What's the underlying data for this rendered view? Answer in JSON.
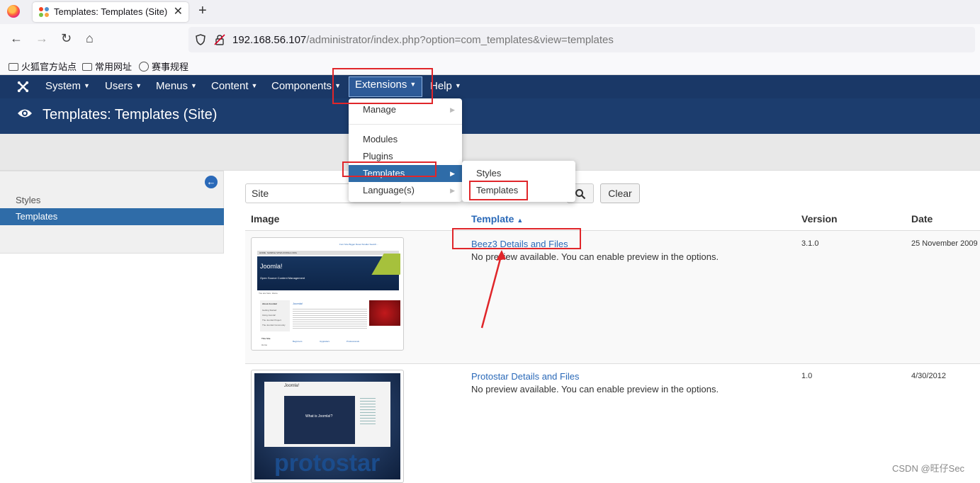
{
  "browser": {
    "tab_title": "Templates: Templates (Site) - ",
    "url_host": "192.168.56.107",
    "url_path": "/administrator/index.php?option=com_templates&view=templates",
    "bookmarks": [
      "火狐官方站点",
      "常用网址",
      "赛事规程"
    ]
  },
  "topmenu": {
    "items": [
      "System",
      "Users",
      "Menus",
      "Content",
      "Components",
      "Extensions",
      "Help"
    ]
  },
  "header": {
    "title": "Templates: Templates (Site)"
  },
  "sidebar": {
    "items": [
      "Styles",
      "Templates"
    ]
  },
  "filters": {
    "site_value": "Site",
    "clear_label": "Clear"
  },
  "table": {
    "headers": [
      "Image",
      "Template",
      "Version",
      "Date"
    ],
    "sort_indicator": "▲",
    "rows": [
      {
        "name": "Beez3 Details and Files",
        "desc": "No preview available. You can enable preview in the options.",
        "version": "3.1.0",
        "date": "25 November 2009"
      },
      {
        "name": "Protostar Details and Files",
        "desc": "No preview available. You can enable preview in the options.",
        "version": "1.0",
        "date": "4/30/2012"
      }
    ]
  },
  "ext_menu": {
    "items": [
      "Manage",
      "Modules",
      "Plugins",
      "Templates",
      "Language(s)"
    ]
  },
  "sub_menu": {
    "items": [
      "Styles",
      "Templates"
    ]
  },
  "thumb1": {
    "top_links": "Font Size Bigger Reset Smaller  Search...",
    "nav": [
      "HOME",
      "SAMPLE SITES",
      "JOOMLA.ORG"
    ],
    "banner_title": "Joomla!",
    "banner_sub": "Open Source Content Management",
    "crumb": "You are here: Home",
    "article_title": "Joomla!",
    "side_heading": "About Joomla!",
    "side_links": [
      "Getting Started",
      "Using Joomla!",
      "The Joomla! Project",
      "The Joomla! Community"
    ],
    "side_heading2": "This Site",
    "side_link2": "Home",
    "cols": [
      "Beginners",
      "Upgraders",
      "Professionals"
    ]
  },
  "thumb2": {
    "brand": "Joomla!",
    "video_text": "What is Joomla!?",
    "logo_text": "protostar"
  },
  "watermark": "CSDN @旺仔Sec",
  "colors": {
    "menubar": "#1a3867",
    "subheader": "#1c3d6e",
    "accent": "#2f6ca8",
    "annotation": "#e0262a"
  }
}
